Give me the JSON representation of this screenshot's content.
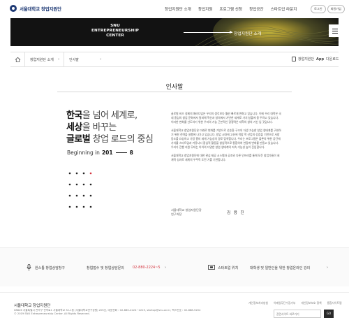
{
  "header": {
    "logo_text": "서울대학교 창업지원단",
    "nav": [
      "창업지원단 소개",
      "창업지원",
      "프로그램 신청",
      "창업공간",
      "스타트업 라운지"
    ],
    "util": [
      "로그인",
      "회원가입"
    ]
  },
  "hero": {
    "title_line1": "SNU",
    "title_line2": "ENTREPRENEURSHIP",
    "title_line3": "CENTER",
    "crumb": "창업지원단 소개"
  },
  "breadcrumb": {
    "level1": "창업지원단 소개",
    "level2": "인사말",
    "app_prefix": "창업지원단",
    "app_bold": "App",
    "app_suffix": "다운로드"
  },
  "content": {
    "page_title": "인사말",
    "slogan": {
      "l1_bold": "한국",
      "l1_rest": "을 넘어 세계로,",
      "l2_bold": "세상",
      "l2_rest": "을 바꾸는",
      "l3_bold": "글로벌",
      "l3_rest": " 창업 로드의 중심"
    },
    "beginning_text": "Beginning in",
    "beginning_year_a": "201",
    "beginning_year_b": "8",
    "paragraphs": [
      "글로벌 비즈 경제의 패러다임은 우리의 생각보다 훨씬 빠르게 변화고 있습니다. 이에 우리 대학은 국내 중심의 창업 문화에서 탈피해 혁신과 창의에서 기반한 세계로 가치 창출에 중 두려고 있습니다. 이러한 변화를 선도하기 위한 우리의 가능 근본적인 경쟁력은 대학의 창의 가신 입 것입니다.",
      "서울대학교 창업지원단은 미래로 변화를 기반으로 선순환 구조의 자생 가능한 창업 생태계를 구현하기 위한 전략을 실행에 나가고 있습니다. 창업 시대에 고유에 적합 학 산업의 강점을 기반으로 사람 동조를 요성하고 가장 흥미 세계 가능성의 경로 탐색합니다. 우리는 프로그램은 물론의 위한 공간에 가치를 스타트업과 커뮤니티 중심적 활동을 창업적으로 통합하여 현장에 변화를 만들고 있습니다. 우리가 진행 지원 무대는 아이의 다양한 창업 생태계의 지속 가능성 높이 진입합니다.",
      "서울대학교 창업지원단에 대한 관심 제공 시스템과 공조와 다른 인프라를 통해 모든 창업가들이 세계적 성과로 세계의 우주적 도전 기를 기반합니다."
    ],
    "sign_org_l1": "서울대학교 창업지원단장",
    "sign_org_l2": "연구처장",
    "sign_name": "김 용 진"
  },
  "contact": {
    "item1": "원스톱 창업상담창구",
    "item2": "창업접수 및 창업상담문의",
    "phone": "02-880-2224~5",
    "item3": "스타트업 위치",
    "item4": "대학생 및 일반인을 위한 창업온라인 강의"
  },
  "footer": {
    "name": "서울대학교 창업지원단",
    "addr1": "08826 서울특별시 관악구 관악로1 서울대학교 32-1동 (서울대학교연구공원) 205호, 대표전화 : 02-880-2224~2225, startup@snu.ac.kr, 팩스번호 : 02-888-5204",
    "addr2": "© 2019 SNU Entrepreneurship Center. All Rights Reserved.",
    "links": [
      "개인정보처리방침",
      "이메일무단수집거부",
      "개인정보보호 정책",
      "통합사이트맵"
    ],
    "select_label": "관련사이트 바로가기",
    "go_label": "GO"
  },
  "colors": {
    "brand": "#1f3a75",
    "hero_bg": "#121212",
    "accent_yellow": "#f4e24a",
    "phone_red": "#d4333e"
  }
}
